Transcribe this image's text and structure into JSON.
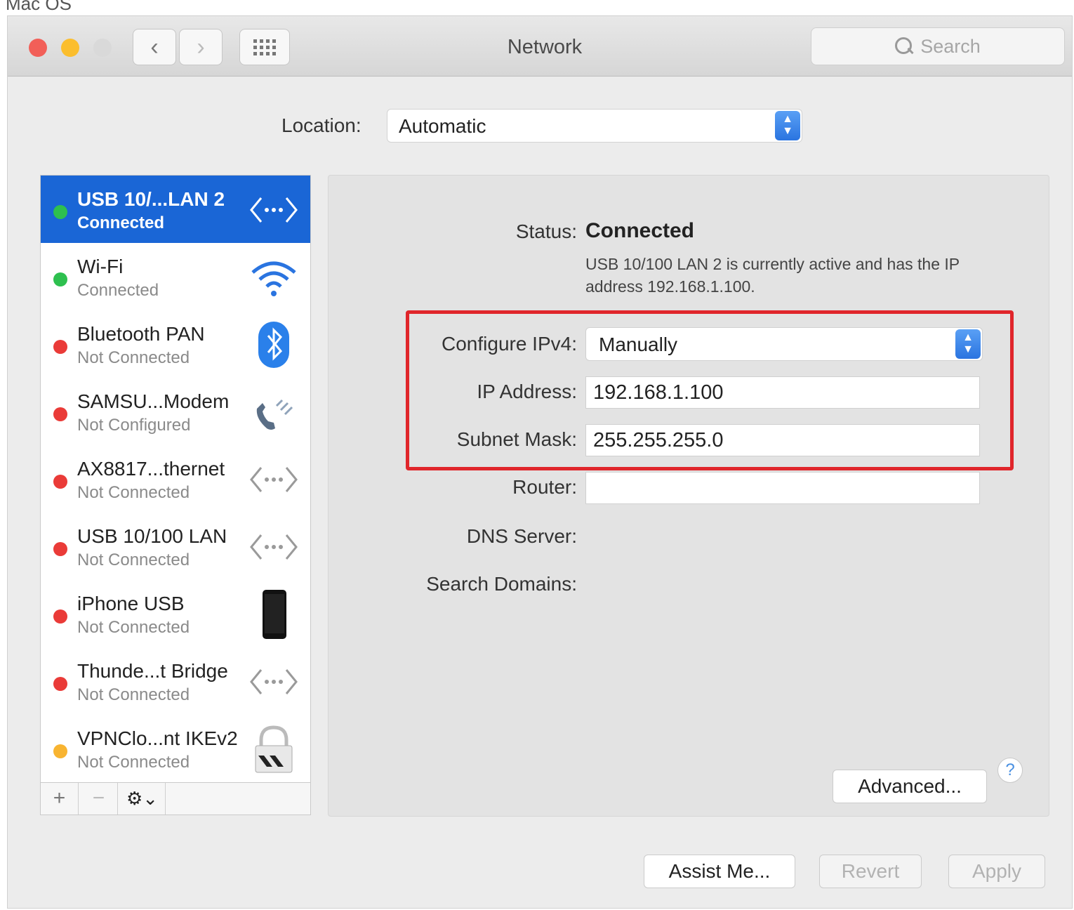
{
  "caption": "Mac OS",
  "window": {
    "title": "Network"
  },
  "toolbar": {
    "back_glyph": "‹",
    "forward_glyph": "›",
    "search_placeholder": "Search"
  },
  "location": {
    "label": "Location:",
    "value": "Automatic"
  },
  "services": [
    {
      "name": "USB 10/...LAN 2",
      "status": "Connected",
      "indicator": "green",
      "icon": "ethernet-icon",
      "selected": true
    },
    {
      "name": "Wi-Fi",
      "status": "Connected",
      "indicator": "green",
      "icon": "wifi-icon"
    },
    {
      "name": "Bluetooth PAN",
      "status": "Not Connected",
      "indicator": "red",
      "icon": "bluetooth-icon"
    },
    {
      "name": "SAMSU...Modem",
      "status": "Not Configured",
      "indicator": "red",
      "icon": "phone-icon"
    },
    {
      "name": "AX8817...thernet",
      "status": "Not Connected",
      "indicator": "red",
      "icon": "ethernet-icon"
    },
    {
      "name": "USB 10/100 LAN",
      "status": "Not Connected",
      "indicator": "red",
      "icon": "ethernet-icon"
    },
    {
      "name": "iPhone USB",
      "status": "Not Connected",
      "indicator": "red",
      "icon": "iphone-icon"
    },
    {
      "name": "Thunde...t Bridge",
      "status": "Not Connected",
      "indicator": "red",
      "icon": "ethernet-icon"
    },
    {
      "name": "VPNClo...nt IKEv2",
      "status": "Not Connected",
      "indicator": "amber",
      "icon": "vpn-lock-icon"
    }
  ],
  "sidebar_controls": {
    "add": "+",
    "remove": "−",
    "gear": "⚙⌄"
  },
  "detail": {
    "status_label": "Status:",
    "status_value": "Connected",
    "status_description": "USB 10/100 LAN 2 is currently active and has the IP address 192.168.1.100.",
    "configure_label": "Configure IPv4:",
    "configure_value": "Manually",
    "ip_label": "IP Address:",
    "ip_value": "192.168.1.100",
    "subnet_label": "Subnet Mask:",
    "subnet_value": "255.255.255.0",
    "router_label": "Router:",
    "router_value": "",
    "dns_label": "DNS Server:",
    "search_domains_label": "Search Domains:",
    "advanced_label": "Advanced...",
    "help_label": "?"
  },
  "footer": {
    "assist_label": "Assist Me...",
    "revert_label": "Revert",
    "apply_label": "Apply"
  },
  "colors": {
    "selection": "#1a66d6",
    "highlight_box": "#e0262b",
    "status_green": "#2ec04f",
    "status_red": "#ea3b38",
    "status_amber": "#f8b431"
  }
}
